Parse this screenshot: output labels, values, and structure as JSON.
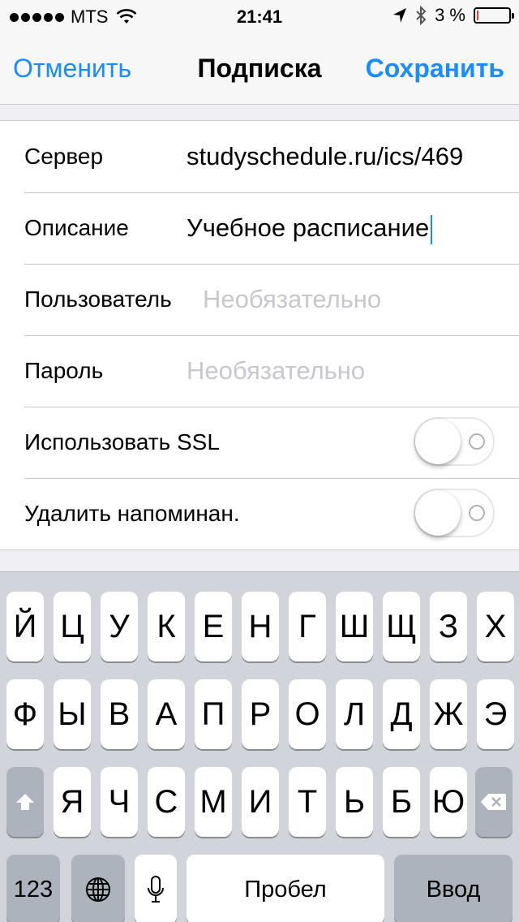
{
  "status_bar": {
    "carrier": "MTS",
    "time": "21:41",
    "battery_percent_text": "3 %",
    "battery_level": 0.03,
    "icons": [
      "signal-dots-icon",
      "wifi-icon",
      "location-arrow-icon",
      "bluetooth-icon",
      "battery-icon"
    ]
  },
  "nav": {
    "cancel_label": "Отменить",
    "title": "Подписка",
    "save_label": "Сохранить"
  },
  "form": {
    "server": {
      "label": "Сервер",
      "value": "studyschedule.ru/ics/469"
    },
    "description": {
      "label": "Описание",
      "value": "Учебное расписание"
    },
    "user": {
      "label": "Пользователь",
      "placeholder": "Необязательно"
    },
    "password": {
      "label": "Пароль",
      "placeholder": "Необязательно"
    },
    "use_ssl": {
      "label": "Использовать SSL",
      "on": false
    },
    "remove_reminders": {
      "label": "Удалить напоминан.",
      "on": false
    }
  },
  "keyboard": {
    "row1": [
      "Й",
      "Ц",
      "У",
      "К",
      "Е",
      "Н",
      "Г",
      "Ш",
      "Щ",
      "З",
      "Х"
    ],
    "row2": [
      "Ф",
      "Ы",
      "В",
      "А",
      "П",
      "Р",
      "О",
      "Л",
      "Д",
      "Ж",
      "Э"
    ],
    "row3": [
      "Я",
      "Ч",
      "С",
      "М",
      "И",
      "Т",
      "Ь",
      "Б",
      "Ю"
    ],
    "numbers_label": "123",
    "space_label": "Пробел",
    "return_label": "Ввод",
    "icons": [
      "shift-icon",
      "backspace-icon",
      "globe-icon",
      "microphone-icon"
    ]
  },
  "colors": {
    "accent": "#1a8cff",
    "placeholder": "#c7c7cd",
    "background": "#efeff4",
    "keyboard_bg": "#d1d5db",
    "battery_low": "#ff3b30"
  }
}
